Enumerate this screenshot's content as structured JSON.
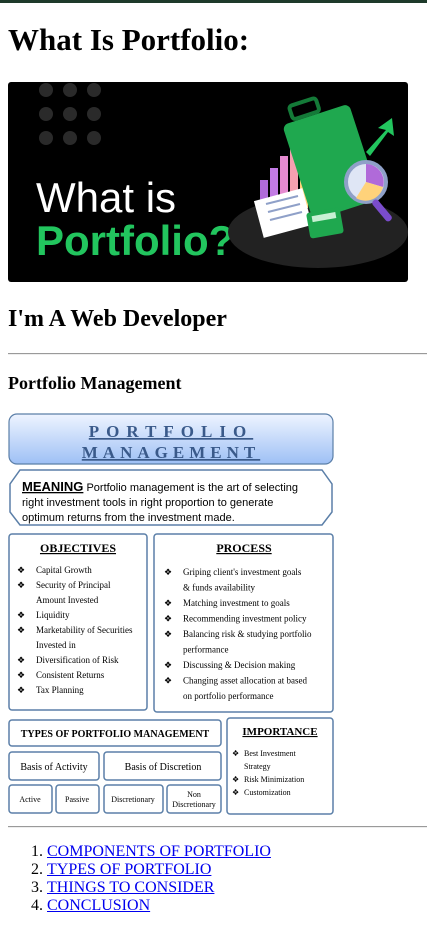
{
  "page": {
    "heading": "What Is Portfolio:",
    "subheading": "I'm A Web Developer",
    "section_title": "Portfolio Management"
  },
  "hero_image": {
    "line1": "What is",
    "line2": "Portfolio?",
    "colors": {
      "background": "#000000",
      "accent": "#22c55e",
      "text": "#ffffff"
    },
    "icons": [
      "briefcase-icon",
      "bar-chart-icon",
      "magnifier-pie-icon",
      "document-icon",
      "calculator-icon",
      "arrow-up-icon"
    ]
  },
  "infographic": {
    "title_line1": "PORTFOLIO",
    "title_line2": "MANAGEMENT",
    "meaning_label": "MEANING",
    "meaning_line1": " Portfolio management is the art of selecting",
    "meaning_line2": "right investment tools in right proportion to generate",
    "meaning_line3": "optimum returns from the investment made.",
    "objectives_title": "OBJECTIVES",
    "objectives": [
      "Capital Growth",
      "Security of Principal",
      "Amount Invested",
      "Liquidity",
      "Marketability of Securities",
      "Invested in",
      "Diversification of Risk",
      "Consistent Returns",
      "Tax Planning"
    ],
    "process_title": "PROCESS",
    "process": [
      "Griping client's investment goals",
      "& funds availability",
      "Matching investment to goals",
      "Recommending investment policy",
      "Balancing risk & studying portfolio",
      "performance",
      "Discussing & Decision making",
      "Changing asset allocation at based",
      "on portfolio performance"
    ],
    "types_title": "TYPES OF PORTFOLIO MANAGEMENT",
    "basis_activity": "Basis of Activity",
    "basis_discretion": "Basis of Discretion",
    "type_active": "Active",
    "type_passive": "Passive",
    "type_discretionary": "Discretionary",
    "type_non1": "Non",
    "type_non2": "Discretionary",
    "importance_title": "IMPORTANCE",
    "importance": [
      "Best Investment",
      "Strategy",
      "Risk Minimization",
      "Customization"
    ],
    "colors": {
      "title_grad_top": "#eef4ff",
      "title_grad_bottom": "#9ec0f5",
      "border": "#5b7fa8",
      "title_text": "#3a5a8a"
    }
  },
  "links": [
    "COMPONENTS OF PORTFOLIO",
    "TYPES OF PORTFOLIO",
    "THINGS TO CONSIDER",
    "CONCLUSION"
  ]
}
